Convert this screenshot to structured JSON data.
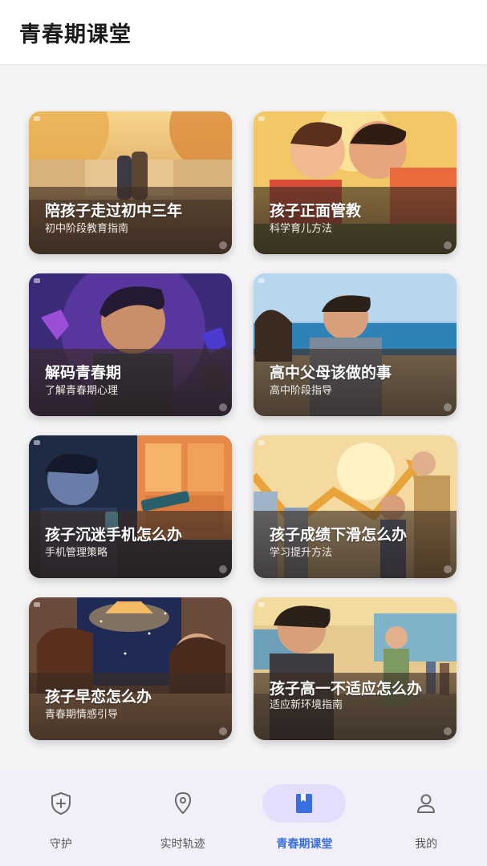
{
  "header": {
    "title": "青春期课堂"
  },
  "cards": [
    {
      "title": "陪孩子走过初中三年",
      "subtitle": "初中阶段教育指南"
    },
    {
      "title": "孩子正面管教",
      "subtitle": "科学育儿方法"
    },
    {
      "title": "解码青春期",
      "subtitle": "了解青春期心理"
    },
    {
      "title": "高中父母该做的事",
      "subtitle": "高中阶段指导"
    },
    {
      "title": "孩子沉迷手机怎么办",
      "subtitle": "手机管理策略"
    },
    {
      "title": "孩子成绩下滑怎么办",
      "subtitle": "学习提升方法"
    },
    {
      "title": "孩子早恋怎么办",
      "subtitle": "青春期情感引导"
    },
    {
      "title": "孩子高一不适应怎么办",
      "subtitle": "适应新环境指南"
    }
  ],
  "bottom_nav": {
    "items": [
      {
        "label": "守护",
        "icon": "shield-plus-icon",
        "active": false
      },
      {
        "label": "实时轨迹",
        "icon": "location-pin-icon",
        "active": false
      },
      {
        "label": "青春期课堂",
        "icon": "book-icon",
        "active": true
      },
      {
        "label": "我的",
        "icon": "person-icon",
        "active": false
      }
    ]
  },
  "colors": {
    "accent": "#3a6fe0",
    "active_pill": "#e4defc",
    "nav_bg": "#f3eff8"
  }
}
